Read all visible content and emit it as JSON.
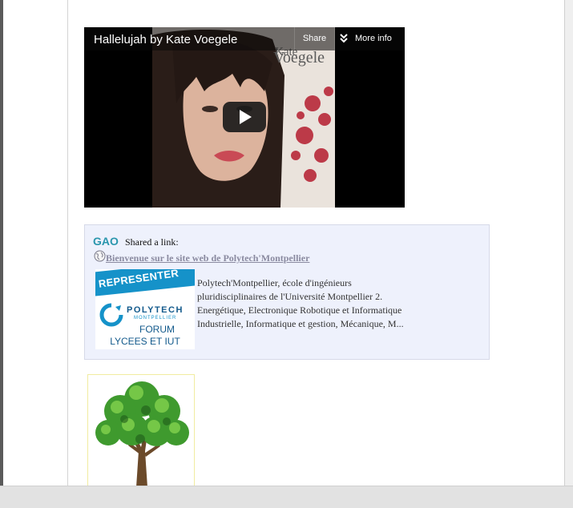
{
  "video": {
    "title": "Hallelujah by Kate Voegele",
    "share_label": "Share",
    "more_info_label": "More info",
    "poster_text": "Kate Voegele"
  },
  "shared_post": {
    "author": "GAO",
    "action": "Shared a link:",
    "link_title": "Bienvenue sur le site web de Polytech'Montpellier",
    "description": "Polytech'Montpellier, école d'ingénieurs pluridisciplinaires de l'Université Montpellier 2. Energétique, Electronique Robotique et Informatique Industrielle, Informatique et gestion, Mécanique, M...",
    "thumbnail": {
      "banner": "REPRESENTER",
      "brand": "POLYTECH",
      "brand_sub": "MONTPELLIER",
      "line1": "FORUM",
      "line2": "LYCEES ET IUT"
    }
  },
  "colors": {
    "author_link": "#2a96ad",
    "share_box_bg": "#eef1fc",
    "thumbnail_blue": "#1592c9"
  }
}
